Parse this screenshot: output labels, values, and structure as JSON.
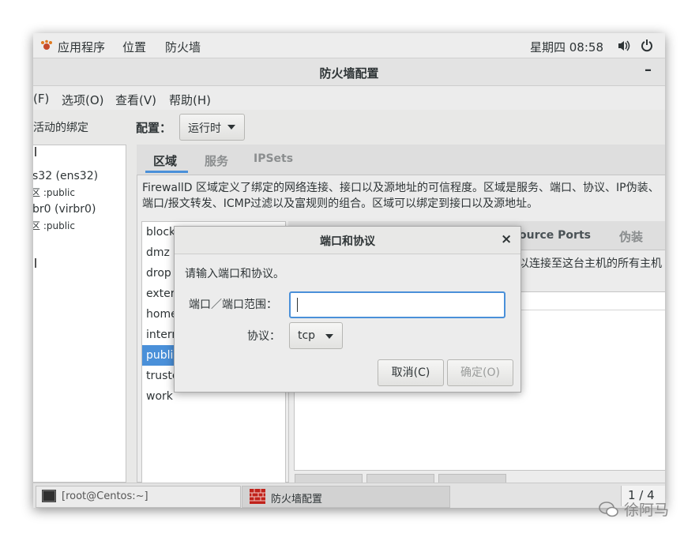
{
  "topbar": {
    "apps_label": "应用程序",
    "places_label": "位置",
    "firewall_label": "防火墙",
    "clock": "星期四 08:58",
    "icons": [
      "gnome-foot-icon",
      "volume-icon",
      "power-icon"
    ]
  },
  "window": {
    "title": "防火墙配置",
    "minimize_glyph": "–"
  },
  "menubar": {
    "items": [
      "(F)",
      "选项(O)",
      "查看(V)",
      "帮助(H)"
    ]
  },
  "left_panel": {
    "heading": "活动的绑定",
    "section_glyph": "  ",
    "connections": [
      {
        "name": "s32 (ens32)",
        "zone_label": "区 :",
        "zone": "public"
      },
      {
        "name": "br0 (virbr0)",
        "zone_label": "区 :",
        "zone": "public"
      }
    ]
  },
  "config": {
    "label": "配置：",
    "value": "运行时"
  },
  "main_tabs": [
    "区域",
    "服务",
    "IPSets"
  ],
  "description": "FirewallD 区域定义了绑定的网络连接、接口以及源地址的可信程度。区域是服务、端口、协议、IP伪装、端口/报文转发、ICMP过滤以及富规则的组合。区域可以绑定到接口以及源地址。",
  "zones": [
    "block",
    "dmz",
    "drop",
    "exter",
    "home",
    "intern",
    "public",
    "truste",
    "work"
  ],
  "selected_zone_index": 6,
  "sub_tabs": [
    "ource Ports",
    "伪装"
  ],
  "sub_description": "以连接至这台主机的所有主机",
  "taskbar": {
    "items": [
      "[root@Centos:~]",
      "防火墙配置"
    ],
    "pager": "1 / 4"
  },
  "dialog": {
    "title": "端口和协议",
    "close_glyph": "×",
    "prompt": "请输入端口和协议。",
    "port_label": "端口／端口范围：",
    "port_value": "",
    "protocol_label": "协议：",
    "protocol_value": "tcp",
    "cancel_label": "取消(C)",
    "ok_label": "确定(O)"
  },
  "watermark": "徐阿马",
  "colors": {
    "selection": "#4a90d9",
    "focus_border": "#4a90d9",
    "background": "#ececec"
  }
}
